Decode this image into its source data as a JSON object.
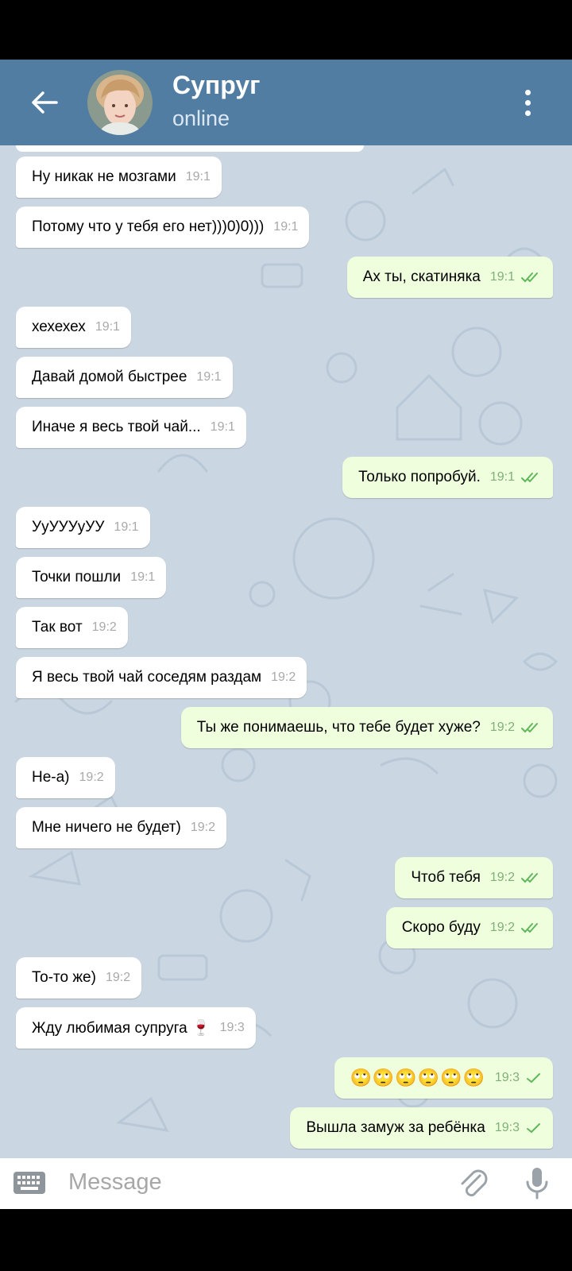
{
  "header": {
    "title": "Супруг",
    "status": "online"
  },
  "messages": [
    {
      "side": "in",
      "text": "Ну никак не мозгами",
      "time": "19:1"
    },
    {
      "side": "in",
      "text": "Потому что у тебя его нет)))0)0)))",
      "time": "19:1"
    },
    {
      "side": "out",
      "text": "Ах ты, скатиняка",
      "time": "19:1",
      "check": "double"
    },
    {
      "side": "in",
      "text": "хехехех",
      "time": "19:1"
    },
    {
      "side": "in",
      "text": "Давай домой быстрее",
      "time": "19:1"
    },
    {
      "side": "in",
      "text": "Иначе я весь твой чай...",
      "time": "19:1"
    },
    {
      "side": "out",
      "text": "Только попробуй.",
      "time": "19:1",
      "check": "double"
    },
    {
      "side": "in",
      "text": "УуУУУуУУ",
      "time": "19:1"
    },
    {
      "side": "in",
      "text": "Точки пошли",
      "time": "19:1"
    },
    {
      "side": "in",
      "text": "Так вот",
      "time": "19:2"
    },
    {
      "side": "in",
      "text": "Я весь твой чай соседям раздам",
      "time": "19:2"
    },
    {
      "side": "out",
      "text": "Ты же понимаешь, что тебе будет хуже?",
      "time": "19:2",
      "check": "double"
    },
    {
      "side": "in",
      "text": "Не-а)",
      "time": "19:2"
    },
    {
      "side": "in",
      "text": "Мне ничего не будет)",
      "time": "19:2"
    },
    {
      "side": "out",
      "text": "Чтоб тебя",
      "time": "19:2",
      "check": "double"
    },
    {
      "side": "out",
      "text": "Скоро буду",
      "time": "19:2",
      "check": "double"
    },
    {
      "side": "in",
      "text": "То-то же)",
      "time": "19:2"
    },
    {
      "side": "in",
      "text": "Жду любимая супруга 🍷",
      "time": "19:3"
    },
    {
      "side": "out",
      "text": "🙄🙄🙄🙄🙄🙄",
      "time": "19:3",
      "check": "single"
    },
    {
      "side": "out",
      "text": "Вышла замуж за ребёнка",
      "time": "19:3",
      "check": "single"
    }
  ],
  "composer": {
    "placeholder": "Message"
  },
  "colors": {
    "header": "#517da2",
    "chat_bg": "#cad6e1",
    "out_bubble": "#effedd",
    "in_bubble": "#ffffff",
    "checkmark": "#5fb85b"
  },
  "icons": [
    "back-arrow-icon",
    "avatar",
    "more-vertical-icon",
    "keyboard-icon",
    "attach-icon",
    "mic-icon",
    "double-check-icon",
    "single-check-icon"
  ]
}
